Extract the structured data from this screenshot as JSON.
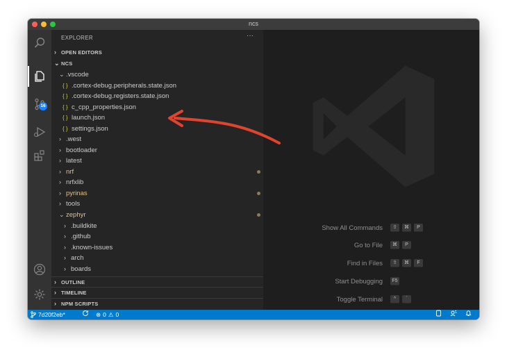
{
  "window": {
    "title": "ncs"
  },
  "activity_bar": {
    "source_control_badge": "16"
  },
  "sidebar": {
    "header": "EXPLORER",
    "more": "···",
    "sections": {
      "open_editors": "OPEN EDITORS",
      "project": "NCS",
      "outline": "OUTLINE",
      "timeline": "TIMELINE",
      "npm_scripts": "NPM SCRIPTS"
    },
    "tree": [
      {
        "label": ".vscode"
      },
      {
        "label": ".cortex-debug.peripherals.state.json"
      },
      {
        "label": ".cortex-debug.registers.state.json"
      },
      {
        "label": "c_cpp_properties.json"
      },
      {
        "label": "launch.json"
      },
      {
        "label": "settings.json"
      },
      {
        "label": ".west"
      },
      {
        "label": "bootloader"
      },
      {
        "label": "latest"
      },
      {
        "label": "nrf"
      },
      {
        "label": "nrfxlib"
      },
      {
        "label": "pyrinas"
      },
      {
        "label": "tools"
      },
      {
        "label": "zephyr"
      },
      {
        "label": ".buildkite"
      },
      {
        "label": ".github"
      },
      {
        "label": ".known-issues"
      },
      {
        "label": "arch"
      },
      {
        "label": "boards"
      }
    ]
  },
  "editor": {
    "shortcuts": [
      {
        "label": "Show All Commands",
        "keys": [
          "⇧",
          "⌘",
          "P"
        ]
      },
      {
        "label": "Go to File",
        "keys": [
          "⌘",
          "P"
        ]
      },
      {
        "label": "Find in Files",
        "keys": [
          "⇧",
          "⌘",
          "F"
        ]
      },
      {
        "label": "Start Debugging",
        "keys": [
          "F5"
        ]
      },
      {
        "label": "Toggle Terminal",
        "keys": [
          "^",
          "`"
        ]
      }
    ]
  },
  "status_bar": {
    "branch": "7d20f2eb*",
    "errors": "0",
    "warnings": "0"
  },
  "colors": {
    "status_bar": "#007acc",
    "annotation_arrow": "#e0442e",
    "modified_file": "#e2c08d",
    "json_icon": "#cbcb41"
  }
}
